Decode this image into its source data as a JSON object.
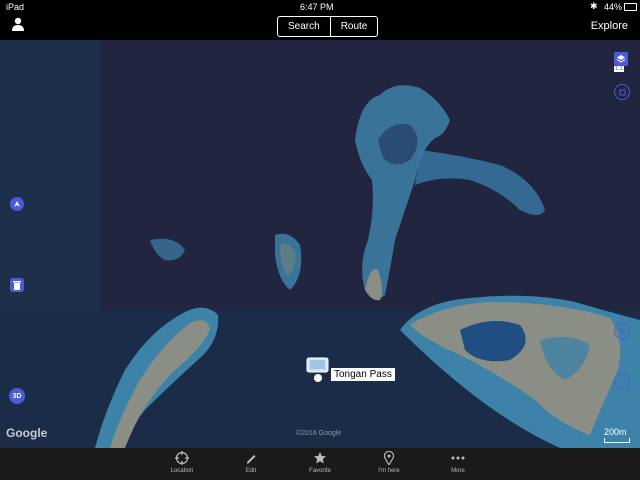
{
  "status_bar": {
    "device": "iPad",
    "time": "6:47 PM",
    "battery": "44%"
  },
  "topbar": {
    "search_label": "Search",
    "route_label": "Route",
    "explore_label": "Explore"
  },
  "map": {
    "pin_label": "Tongan Pass",
    "google_logo": "Google",
    "copyright": "©2016 Google",
    "scale_label": "200m",
    "layers_badge": "1:1",
    "three_d_label": "3D"
  },
  "tabbar": {
    "items": [
      {
        "label": "Location",
        "icon": "target-icon"
      },
      {
        "label": "Edit",
        "icon": "pencil-icon"
      },
      {
        "label": "Favorite",
        "icon": "star-icon"
      },
      {
        "label": "I'm here",
        "icon": "pin-icon"
      },
      {
        "label": "More",
        "icon": "more-icon"
      }
    ]
  },
  "colors": {
    "ocean": "#1b2c48",
    "reef": "#3d82a8",
    "land": "#8a8e84",
    "accent": "#4a5cd8"
  }
}
